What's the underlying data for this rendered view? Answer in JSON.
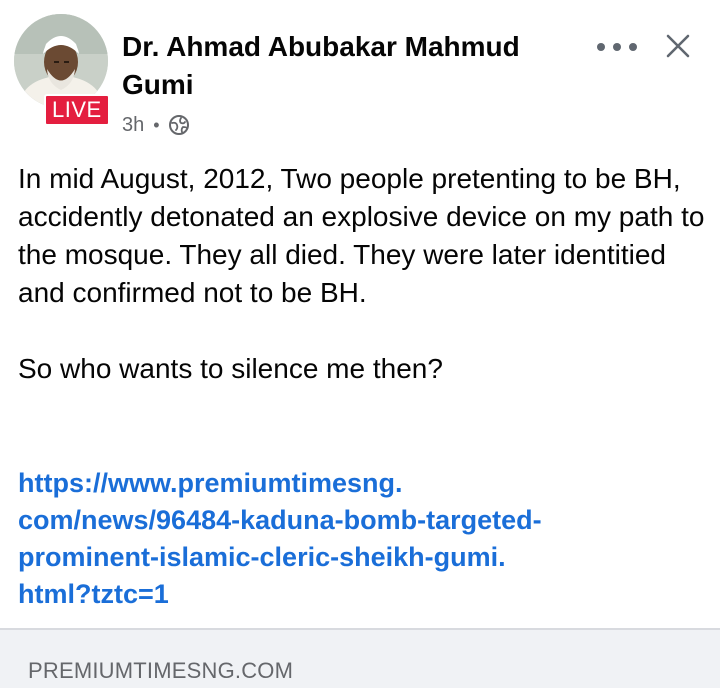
{
  "post": {
    "author": "Dr. Ahmad Abubakar Mahmud Gumi",
    "live_badge": "LIVE",
    "time": "3h",
    "separator": "•",
    "privacy_icon": "globe-icon",
    "more_icon": "more-horizontal-icon",
    "close_icon": "close-icon",
    "text_lines": [
      "In mid August, 2012, Two people pretenting to be BH, accidently detonated an explosive device on my path to the mosque. They all died. They were later identitied and confirmed not to be BH."
    ],
    "question": "So who wants to silence me then?",
    "link_lines": [
      "https://www.premiumtimesng.",
      "com/news/96484-kaduna-bomb-targeted-",
      "prominent-islamic-cleric-sheikh-gumi.",
      "html?tztc=1"
    ]
  },
  "link_preview": {
    "domain": "PREMIUMTIMESNG.COM"
  },
  "colors": {
    "live_red": "#e41e3f",
    "link_blue": "#1a6ed8",
    "meta_gray": "#65676b"
  }
}
